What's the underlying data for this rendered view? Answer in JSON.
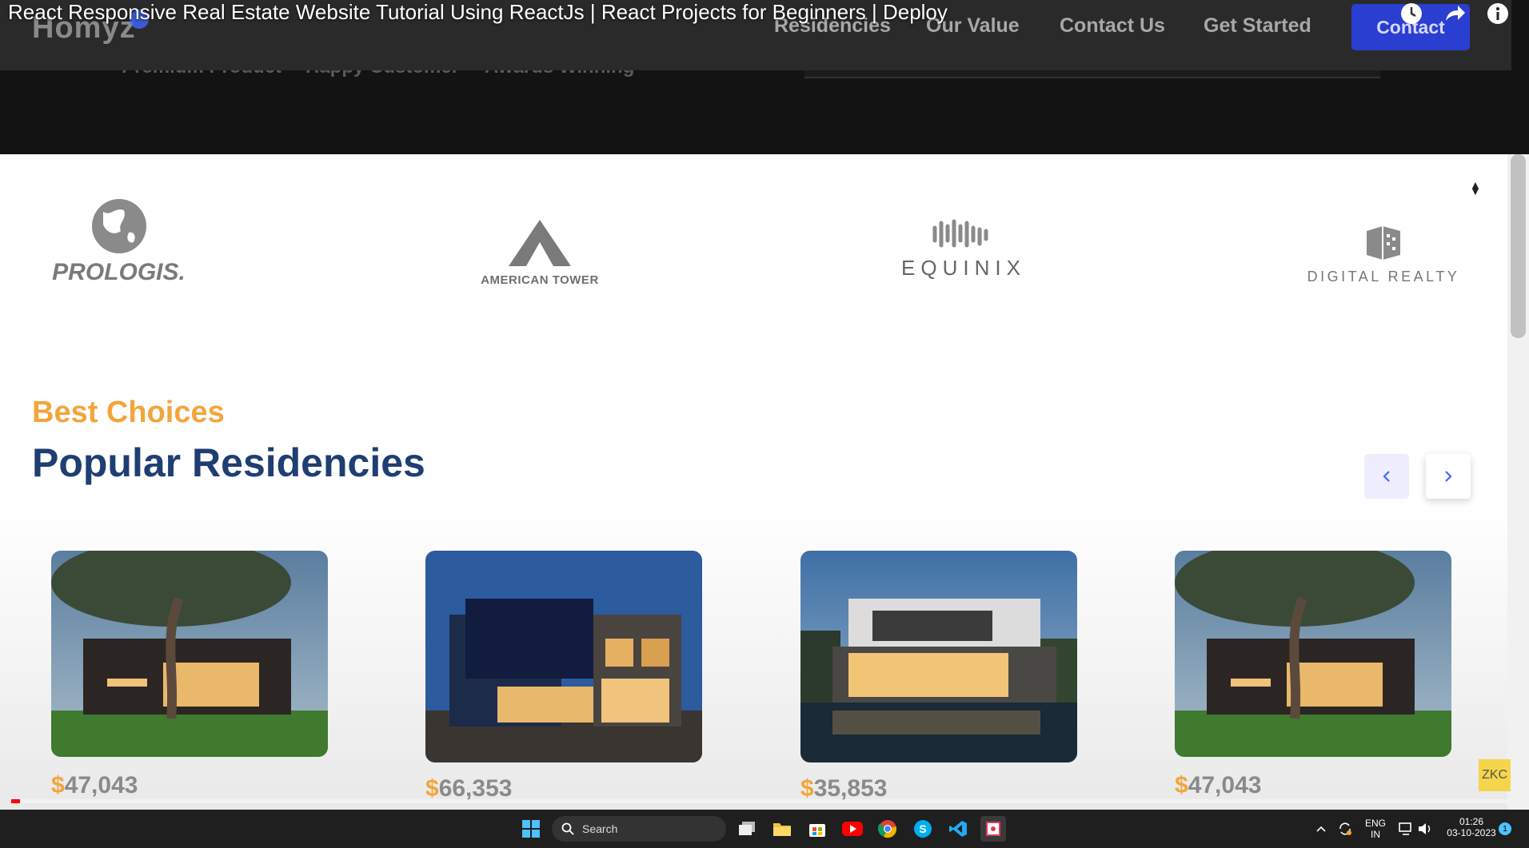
{
  "video_title": "React Responsive Real Estate Website Tutorial Using ReactJs | React Projects for Beginners | Deploy",
  "site": {
    "logo": "Homyz",
    "nav": [
      "Residencies",
      "Our Value",
      "Contact Us",
      "Get Started"
    ],
    "contact_button": "Contact",
    "hero_stats": [
      "Premium Product",
      "Happy Customer",
      "Awards Winning"
    ]
  },
  "companies": [
    "PROLOGIS.",
    "AMERICAN TOWER",
    "EQUINIX",
    "DIGITAL REALTY"
  ],
  "residencies": {
    "eyebrow": "Best Choices",
    "heading": "Popular Residencies",
    "prev_icon": "chevron-left-icon",
    "next_icon": "chevron-right-icon",
    "cards": [
      {
        "price": "47,043"
      },
      {
        "price": "66,353"
      },
      {
        "price": "35,853"
      },
      {
        "price": "47,043"
      }
    ]
  },
  "watermark": "ZKC",
  "video_progress": 0.006,
  "taskbar": {
    "search_placeholder": "Search",
    "language": "ENG",
    "region": "IN",
    "time": "01:26",
    "date": "03-10-2023",
    "notifications": "1"
  },
  "colors": {
    "accent_orange": "#f3a53b",
    "heading_blue": "#1f3e72",
    "primary_blue": "#4066ff"
  }
}
